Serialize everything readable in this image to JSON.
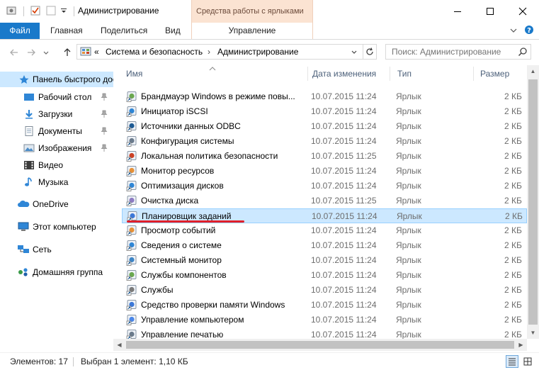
{
  "window": {
    "title": "Администрирование",
    "context_tab_title": "Средства работы с ярлыками"
  },
  "ribbon": {
    "tabs": [
      "Файл",
      "Главная",
      "Поделиться",
      "Вид"
    ],
    "context_tab": "Управление"
  },
  "address": {
    "overflow": "«",
    "crumbs": [
      "Система и безопасность",
      "Администрирование"
    ]
  },
  "search": {
    "placeholder": "Поиск: Администрирование"
  },
  "nav": {
    "items": [
      {
        "label": "Панель быстрого доступа",
        "icon": "star-icon"
      },
      {
        "label": "Рабочий стол",
        "icon": "desktop-icon"
      },
      {
        "label": "Загрузки",
        "icon": "download-icon"
      },
      {
        "label": "Документы",
        "icon": "documents-icon"
      },
      {
        "label": "Изображения",
        "icon": "pictures-icon"
      },
      {
        "label": "Видео",
        "icon": "video-icon"
      },
      {
        "label": "Музыка",
        "icon": "music-icon"
      },
      {
        "label": "OneDrive",
        "icon": "onedrive-icon"
      },
      {
        "label": "Этот компьютер",
        "icon": "computer-icon"
      },
      {
        "label": "Сеть",
        "icon": "network-icon"
      },
      {
        "label": "Домашняя группа",
        "icon": "homegroup-icon"
      }
    ]
  },
  "columns": {
    "name": "Имя",
    "date": "Дата изменения",
    "type": "Тип",
    "size": "Размер"
  },
  "files": [
    {
      "name": "Брандмауэр Windows в режиме повы...",
      "date": "10.07.2015 11:24",
      "type": "Ярлык",
      "size": "2 КБ"
    },
    {
      "name": "Инициатор iSCSI",
      "date": "10.07.2015 11:24",
      "type": "Ярлык",
      "size": "2 КБ"
    },
    {
      "name": "Источники данных ODBC",
      "date": "10.07.2015 11:24",
      "type": "Ярлык",
      "size": "2 КБ"
    },
    {
      "name": "Конфигурация системы",
      "date": "10.07.2015 11:24",
      "type": "Ярлык",
      "size": "2 КБ"
    },
    {
      "name": "Локальная политика безопасности",
      "date": "10.07.2015 11:25",
      "type": "Ярлык",
      "size": "2 КБ"
    },
    {
      "name": "Монитор ресурсов",
      "date": "10.07.2015 11:24",
      "type": "Ярлык",
      "size": "2 КБ"
    },
    {
      "name": "Оптимизация дисков",
      "date": "10.07.2015 11:24",
      "type": "Ярлык",
      "size": "2 КБ"
    },
    {
      "name": "Очистка диска",
      "date": "10.07.2015 11:25",
      "type": "Ярлык",
      "size": "2 КБ"
    },
    {
      "name": "Планировщик заданий",
      "date": "10.07.2015 11:24",
      "type": "Ярлык",
      "size": "2 КБ"
    },
    {
      "name": "Просмотр событий",
      "date": "10.07.2015 11:24",
      "type": "Ярлык",
      "size": "2 КБ"
    },
    {
      "name": "Сведения о системе",
      "date": "10.07.2015 11:24",
      "type": "Ярлык",
      "size": "2 КБ"
    },
    {
      "name": "Системный монитор",
      "date": "10.07.2015 11:24",
      "type": "Ярлык",
      "size": "2 КБ"
    },
    {
      "name": "Службы компонентов",
      "date": "10.07.2015 11:24",
      "type": "Ярлык",
      "size": "2 КБ"
    },
    {
      "name": "Службы",
      "date": "10.07.2015 11:24",
      "type": "Ярлык",
      "size": "2 КБ"
    },
    {
      "name": "Средство проверки памяти Windows",
      "date": "10.07.2015 11:24",
      "type": "Ярлык",
      "size": "2 КБ"
    },
    {
      "name": "Управление компьютером",
      "date": "10.07.2015 11:24",
      "type": "Ярлык",
      "size": "2 КБ"
    },
    {
      "name": "Управление печатью",
      "date": "10.07.2015 11:24",
      "type": "Ярлык",
      "size": "2 КБ"
    }
  ],
  "selected_file": "Планировщик заданий",
  "status": {
    "count": "Элементов: 17",
    "selection": "Выбран 1 элемент: 1,10 КБ"
  },
  "colors": {
    "file_tab": "#1979ca",
    "context_band": "#fbe3d2",
    "selection": "#cce8ff",
    "annotation_underline": "#e0202a"
  }
}
